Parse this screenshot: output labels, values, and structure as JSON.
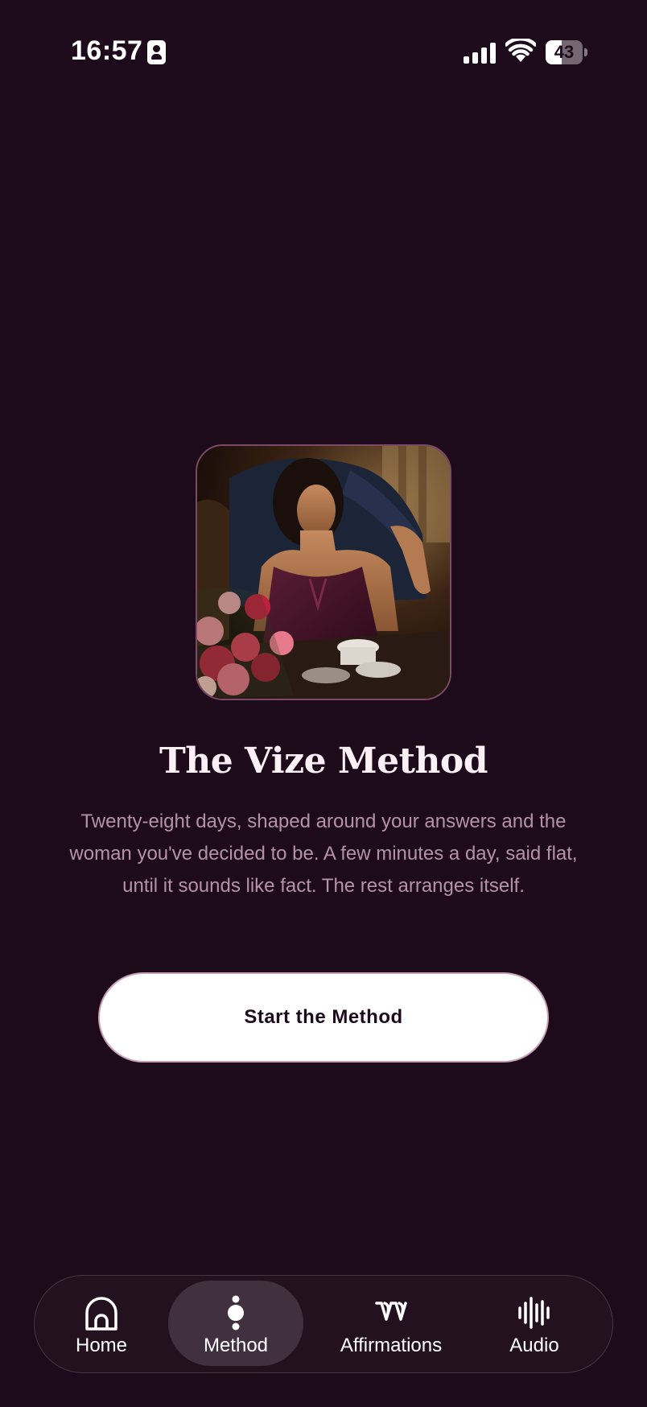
{
  "status_bar": {
    "time": "16:57",
    "battery_level": "43",
    "battery_fraction": 0.43
  },
  "hero": {
    "image_icon": "hero-photo"
  },
  "method": {
    "title": "The Vize Method",
    "description": "Twenty-eight days, shaped around your answers and the woman you've decided to be. A few minutes a day, said flat, until it sounds like fact. The rest arranges itself.",
    "start_label": "Start the Method"
  },
  "tab_bar": {
    "active": "method",
    "tabs": [
      {
        "id": "home",
        "label": "Home",
        "icon": "home-arch-icon"
      },
      {
        "id": "method",
        "label": "Method",
        "icon": "method-beads-icon"
      },
      {
        "id": "affirmations",
        "label": "Affirmations",
        "icon": "quote-icon"
      },
      {
        "id": "audio",
        "label": "Audio",
        "icon": "waveform-icon"
      }
    ]
  },
  "colors": {
    "background": "#1d0b1c",
    "muted_text": "#b592a8",
    "button_bg": "#ffffff",
    "tab_active_bg": "#413040"
  }
}
